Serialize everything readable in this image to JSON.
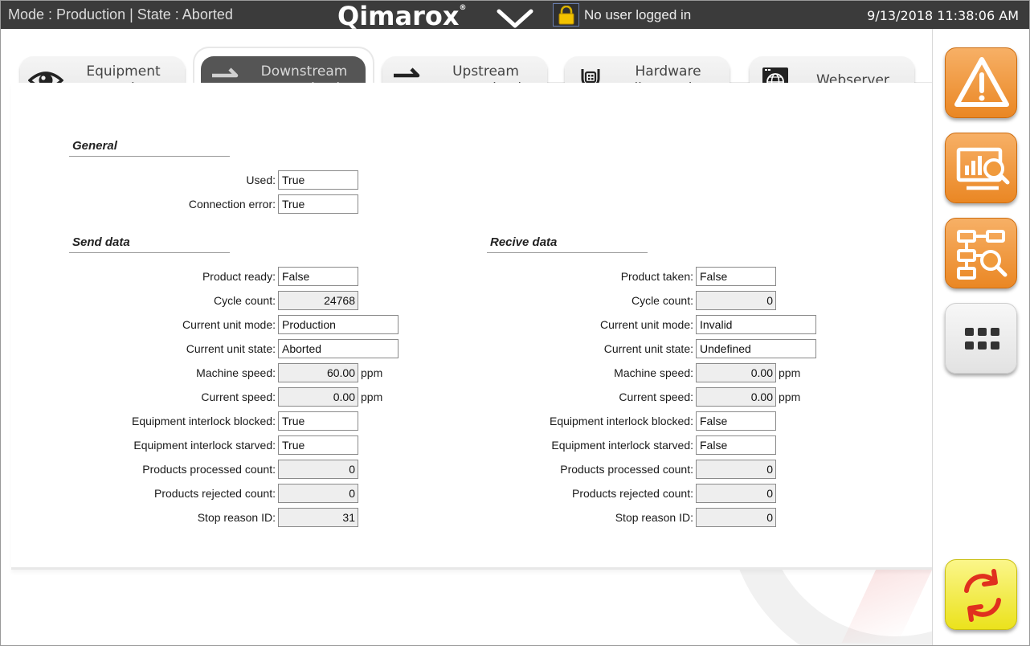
{
  "header": {
    "mode_state": "Mode : Production  |  State : Aborted",
    "logo": "Qimarox",
    "logo_mark": "®",
    "user_status": "No user logged in",
    "datetime": "9/13/2018 11:38:06 AM"
  },
  "tabs": [
    {
      "label": "Equipment overview",
      "icon": "eye-icon",
      "active": false
    },
    {
      "label": "Downstream communication",
      "icon": "arrows-exchange-icon",
      "active": true
    },
    {
      "label": "Upstream communication",
      "icon": "arrows-exchange-icon",
      "active": false
    },
    {
      "label": "Hardware diagnostics",
      "icon": "stethoscope-icon",
      "active": false
    },
    {
      "label": "Webserver",
      "icon": "globe-icon",
      "active": false
    }
  ],
  "general": {
    "title": "General",
    "used_label": "Used:",
    "used_value": "True",
    "conn_error_label": "Connection error:",
    "conn_error_value": "True"
  },
  "send": {
    "title": "Send data",
    "product_ready_label": "Product ready:",
    "product_ready": "False",
    "cycle_count_label": "Cycle count:",
    "cycle_count": "24768",
    "unit_mode_label": "Current unit mode:",
    "unit_mode": "Production",
    "unit_state_label": "Current unit state:",
    "unit_state": "Aborted",
    "machine_speed_label": "Machine speed:",
    "machine_speed": "60.00",
    "current_speed_label": "Current speed:",
    "current_speed": "0.00",
    "blocked_label": "Equipment interlock blocked:",
    "blocked": "True",
    "starved_label": "Equipment interlock starved:",
    "starved": "True",
    "processed_label": "Products processed count:",
    "processed": "0",
    "rejected_label": "Products rejected count:",
    "rejected": "0",
    "stop_reason_label": "Stop reason ID:",
    "stop_reason": "31"
  },
  "receive": {
    "title": "Recive data",
    "product_taken_label": "Product taken:",
    "product_taken": "False",
    "cycle_count_label": "Cycle count:",
    "cycle_count": "0",
    "unit_mode_label": "Current unit mode:",
    "unit_mode": "Invalid",
    "unit_state_label": "Current unit state:",
    "unit_state": "Undefined",
    "machine_speed_label": "Machine speed:",
    "machine_speed": "0.00",
    "current_speed_label": "Current speed:",
    "current_speed": "0.00",
    "blocked_label": "Equipment interlock blocked:",
    "blocked": "False",
    "starved_label": "Equipment interlock starved:",
    "starved": "False",
    "processed_label": "Products processed count:",
    "processed": "0",
    "rejected_label": "Products rejected count:",
    "rejected": "0",
    "stop_reason_label": "Stop reason ID:",
    "stop_reason": "0"
  },
  "units": {
    "speed": "ppm"
  },
  "sidebar": {
    "buttons": [
      "warning-icon",
      "monitor-chart-icon",
      "flowchart-search-icon",
      "more-icon",
      "refresh-icon"
    ]
  },
  "colors": {
    "topbar": "#3b3b3b",
    "active_tab": "#555555",
    "orange_button": "#ea8724",
    "yellow_button": "#ebe21c",
    "refresh_icon": "#e0301e"
  }
}
